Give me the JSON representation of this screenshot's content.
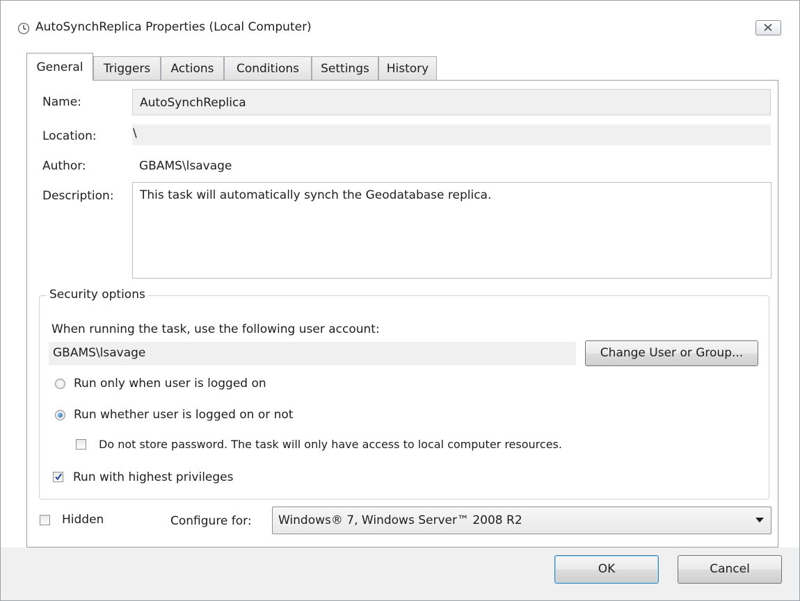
{
  "window": {
    "title": "AutoSynchReplica Properties (Local Computer)"
  },
  "tabs": [
    {
      "label": "General",
      "active": true
    },
    {
      "label": "Triggers",
      "active": false
    },
    {
      "label": "Actions",
      "active": false
    },
    {
      "label": "Conditions",
      "active": false
    },
    {
      "label": "Settings",
      "active": false
    },
    {
      "label": "History",
      "active": false
    }
  ],
  "general": {
    "name_label": "Name:",
    "name_value": "AutoSynchReplica",
    "location_label": "Location:",
    "location_value": "\\",
    "author_label": "Author:",
    "author_value": "GBAMS\\lsavage",
    "description_label": "Description:",
    "description_value": "This task will automatically synch the Geodatabase replica."
  },
  "security": {
    "legend": "Security options",
    "account_prompt": "When running the task, use the following user account:",
    "account_value": "GBAMS\\lsavage",
    "change_user_button": "Change User or Group...",
    "radio_logged_on": {
      "label": "Run only when user is logged on",
      "selected": false
    },
    "radio_whether": {
      "label": "Run whether user is logged on or not",
      "selected": true
    },
    "no_store_password": {
      "label": "Do not store password.  The task will only have access to local computer resources.",
      "checked": false
    },
    "highest_privileges": {
      "label": "Run with highest privileges",
      "checked": true
    }
  },
  "footer": {
    "hidden": {
      "label": "Hidden",
      "checked": false
    },
    "configure_label": "Configure for:",
    "configure_value": "Windows® 7, Windows Server™ 2008 R2"
  },
  "buttons": {
    "ok": "OK",
    "cancel": "Cancel"
  },
  "colors": {
    "accent": "#1b5d9b",
    "readonly_bg": "#f0f0f0",
    "dialog_bg": "#f0f0f0"
  }
}
